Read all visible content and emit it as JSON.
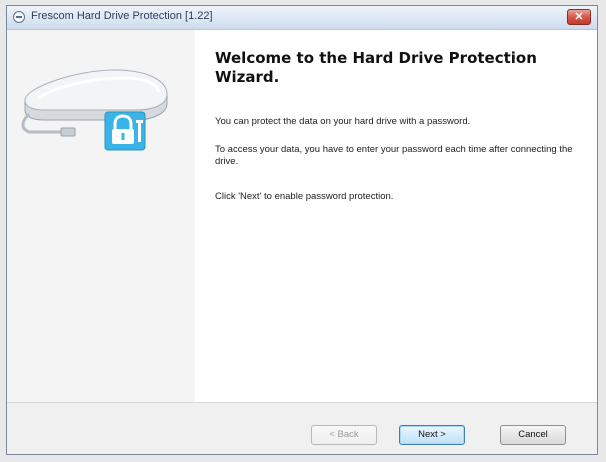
{
  "window": {
    "title": "Frescom Hard Drive Protection [1.22]",
    "close_label": "✕"
  },
  "wizard": {
    "heading": "Welcome to the Hard Drive Protection Wizard.",
    "paragraphs": [
      "You can protect the data on your hard drive with a password.",
      "To access your data, you have to enter your password each time after connecting the drive.",
      "Click 'Next' to enable password protection."
    ],
    "illustration": {
      "icons": [
        "hard-drive-icon",
        "padlock-icon"
      ],
      "accent_color": "#39b4e6"
    }
  },
  "buttons": {
    "back_label": "< Back",
    "back_enabled": false,
    "next_label": "Next >",
    "cancel_label": "Cancel"
  }
}
